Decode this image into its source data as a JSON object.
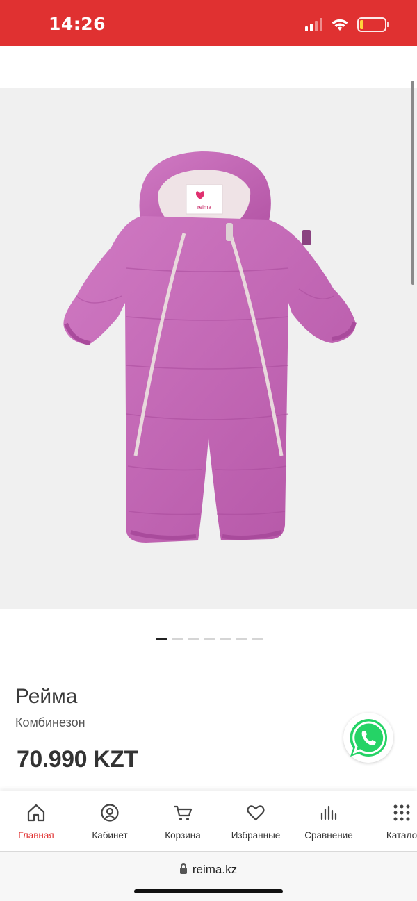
{
  "status_bar": {
    "time": "14:26",
    "bg_color": "#e03131",
    "icons": [
      "signal-icon",
      "wifi-icon",
      "battery-low-icon"
    ]
  },
  "product": {
    "brand": "Рейма",
    "name": "Комбинезон",
    "price": "70.990 KZT",
    "image_label": "reima",
    "image_color": "#c767b8",
    "carousel": {
      "total": 7,
      "active": 1
    }
  },
  "whatsapp": {
    "icon": "whatsapp-icon",
    "color": "#25d366"
  },
  "tabbar": {
    "items": [
      {
        "label": "Главная",
        "icon": "home-icon",
        "active": true
      },
      {
        "label": "Кабинет",
        "icon": "user-icon",
        "active": false
      },
      {
        "label": "Корзина",
        "icon": "cart-icon",
        "active": false
      },
      {
        "label": "Избранные",
        "icon": "heart-icon",
        "active": false
      },
      {
        "label": "Сравнение",
        "icon": "compare-chart-icon",
        "active": false
      },
      {
        "label": "Катало",
        "icon": "catalog-grid-icon",
        "active": false
      }
    ],
    "accent": "#e03131"
  },
  "browser": {
    "url": "reima.kz"
  }
}
